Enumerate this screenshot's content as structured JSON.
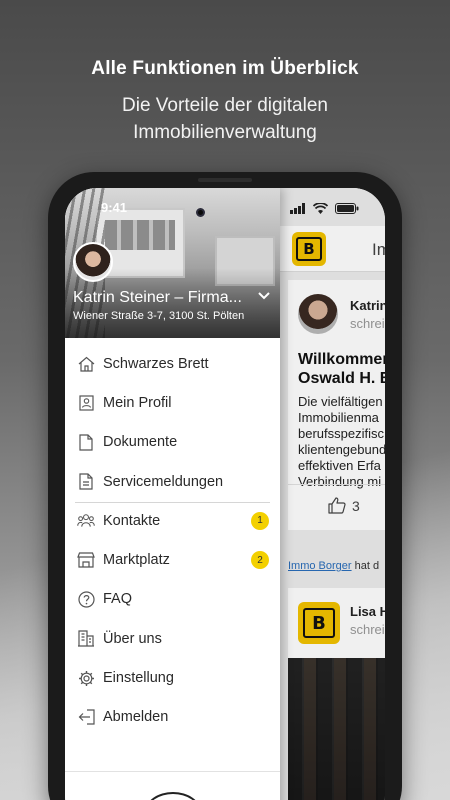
{
  "promo": {
    "headline": "Alle Funktionen im Überblick",
    "subline_1": "Die Vorteile der digitalen",
    "subline_2": "Immobilienverwaltung"
  },
  "status_bar": {
    "time": "9:41"
  },
  "drawer": {
    "user_name": "Katrin Steiner – Firma...",
    "address": "Wiener Straße 3-7, 3100 St. Pölten",
    "items": [
      {
        "label": "Schwarzes Brett",
        "icon": "home-icon"
      },
      {
        "label": "Mein Profil",
        "icon": "profile-card-icon"
      },
      {
        "label": "Dokumente",
        "icon": "document-icon"
      },
      {
        "label": "Servicemeldungen",
        "icon": "service-report-icon"
      },
      {
        "label": "Kontakte",
        "icon": "contacts-icon",
        "badge": "1"
      },
      {
        "label": "Marktplatz",
        "icon": "store-icon",
        "badge": "2"
      },
      {
        "label": "FAQ",
        "icon": "question-icon"
      },
      {
        "label": "Über uns",
        "icon": "building-icon"
      },
      {
        "label": "Einstellung",
        "icon": "gear-icon"
      },
      {
        "label": "Abmelden",
        "icon": "logout-icon"
      }
    ]
  },
  "feed": {
    "header_title": "Im",
    "post1": {
      "author": "Katrin",
      "action": "schreib",
      "title_1": "Willkommen",
      "title_2": "Oswald H. B",
      "body_1": "Die vielfältigen",
      "body_2": "Immobilienma",
      "body_3": "berufsspezifisc",
      "body_4": "klientengebund",
      "body_5": "effektiven Erfa",
      "body_6": "Verbindung mi",
      "likes": "3"
    },
    "mention_link": "Immo Borger",
    "mention_text": " hat d",
    "post2": {
      "author": "Lisa H",
      "action": "schreib"
    }
  },
  "colors": {
    "accent": "#f3d000",
    "logo_yellow": "#f3c300",
    "link": "#2a6ebb"
  }
}
